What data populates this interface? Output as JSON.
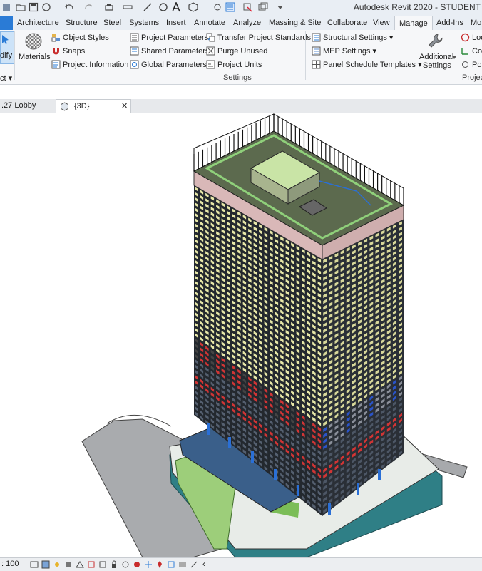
{
  "window": {
    "title": "Autodesk Revit 2020 - STUDENT"
  },
  "tabs": [
    {
      "label": "Architecture"
    },
    {
      "label": "Structure"
    },
    {
      "label": "Steel"
    },
    {
      "label": "Systems"
    },
    {
      "label": "Insert"
    },
    {
      "label": "Annotate"
    },
    {
      "label": "Analyze"
    },
    {
      "label": "Massing & Site"
    },
    {
      "label": "Collaborate"
    },
    {
      "label": "View"
    },
    {
      "label": "Manage"
    },
    {
      "label": "Add-Ins"
    },
    {
      "label": "Mo"
    }
  ],
  "ribbon": {
    "modify": {
      "label1": "dify",
      "label2": "ct ▾"
    },
    "materials": {
      "label": "Materials"
    },
    "object_styles": "Object  Styles",
    "snaps": "Snaps",
    "project_information": "Project  Information",
    "project_parameters": "Project  Parameters",
    "shared_parameters": "Shared  Parameters",
    "global_parameters": "Global  Parameters",
    "transfer_project_standards": "Transfer  Project Standards",
    "purge_unused": "Purge  Unused",
    "project_units": "Project  Units",
    "structural_settings": "Structural  Settings  ▾",
    "mep_settings": "MEP  Settings  ▾",
    "panel_schedule_templates": "Panel Schedule  Templates  ▾",
    "additional_settings_1": "Additional",
    "additional_settings_2": "Settings",
    "settings_panel_label": "Settings",
    "location": "Loc",
    "coordinates": "Co",
    "position": "Po",
    "project_panel_label": "Projec"
  },
  "view_tabs": {
    "lobby": ".27 Lobby",
    "three_d": "{3D}",
    "close": "✕"
  },
  "status_bar": {
    "scale": ": 100",
    "chevron": "‹"
  },
  "colors": {
    "accent_blue": "#2a7bd6",
    "tower_dark": "#20252b",
    "window_yellow": "#e8e8a8",
    "parapet_pink": "#d9b8b8",
    "red_levels": "#d13535",
    "site_green": "#9dce7a",
    "teal_base": "#2f7f86"
  }
}
